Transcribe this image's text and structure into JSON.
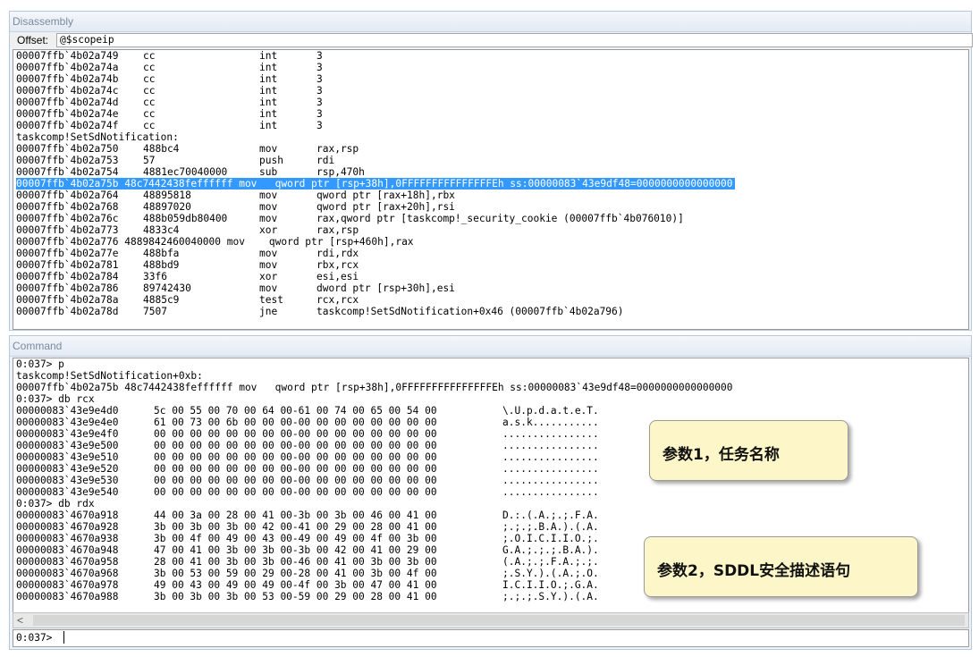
{
  "disassembly": {
    "title": "Disassembly",
    "offset_label": "Offset:",
    "offset_value": "@$scopeip",
    "lines": [
      {
        "addr": "00007ffb`4b02a749",
        "bytes": "cc",
        "mnem": "int",
        "ops": "3"
      },
      {
        "addr": "00007ffb`4b02a74a",
        "bytes": "cc",
        "mnem": "int",
        "ops": "3"
      },
      {
        "addr": "00007ffb`4b02a74b",
        "bytes": "cc",
        "mnem": "int",
        "ops": "3"
      },
      {
        "addr": "00007ffb`4b02a74c",
        "bytes": "cc",
        "mnem": "int",
        "ops": "3"
      },
      {
        "addr": "00007ffb`4b02a74d",
        "bytes": "cc",
        "mnem": "int",
        "ops": "3"
      },
      {
        "addr": "00007ffb`4b02a74e",
        "bytes": "cc",
        "mnem": "int",
        "ops": "3"
      },
      {
        "addr": "00007ffb`4b02a74f",
        "bytes": "cc",
        "mnem": "int",
        "ops": "3"
      },
      {
        "label": "taskcomp!SetSdNotification:"
      },
      {
        "addr": "00007ffb`4b02a750",
        "bytes": "488bc4",
        "mnem": "mov",
        "ops": "rax,rsp"
      },
      {
        "addr": "00007ffb`4b02a753",
        "bytes": "57",
        "mnem": "push",
        "ops": "rdi"
      },
      {
        "addr": "00007ffb`4b02a754",
        "bytes": "4881ec70040000",
        "mnem": "sub",
        "ops": "rsp,470h"
      },
      {
        "highlight": "00007ffb`4b02a75b 48c7442438feffffff mov   qword ptr [rsp+38h],0FFFFFFFFFFFFFFFEh ss:00000083`43e9df48=0000000000000000"
      },
      {
        "addr": "00007ffb`4b02a764",
        "bytes": "48895818",
        "mnem": "mov",
        "ops": "qword ptr [rax+18h],rbx"
      },
      {
        "addr": "00007ffb`4b02a768",
        "bytes": "48897020",
        "mnem": "mov",
        "ops": "qword ptr [rax+20h],rsi"
      },
      {
        "addr": "00007ffb`4b02a76c",
        "bytes": "488b059db80400",
        "mnem": "mov",
        "ops": "rax,qword ptr [taskcomp!_security_cookie (00007ffb`4b076010)]"
      },
      {
        "addr": "00007ffb`4b02a773",
        "bytes": "4833c4",
        "mnem": "xor",
        "ops": "rax,rsp"
      },
      {
        "raw": "00007ffb`4b02a776 4889842460040000 mov    qword ptr [rsp+460h],rax"
      },
      {
        "addr": "00007ffb`4b02a77e",
        "bytes": "488bfa",
        "mnem": "mov",
        "ops": "rdi,rdx"
      },
      {
        "addr": "00007ffb`4b02a781",
        "bytes": "488bd9",
        "mnem": "mov",
        "ops": "rbx,rcx"
      },
      {
        "addr": "00007ffb`4b02a784",
        "bytes": "33f6",
        "mnem": "xor",
        "ops": "esi,esi"
      },
      {
        "addr": "00007ffb`4b02a786",
        "bytes": "89742430",
        "mnem": "mov",
        "ops": "dword ptr [rsp+30h],esi"
      },
      {
        "addr": "00007ffb`4b02a78a",
        "bytes": "4885c9",
        "mnem": "test",
        "ops": "rcx,rcx"
      },
      {
        "addr": "00007ffb`4b02a78d",
        "bytes": "7507",
        "mnem": "jne",
        "ops": "taskcomp!SetSdNotification+0x46 (00007ffb`4b02a796)"
      }
    ]
  },
  "command": {
    "title": "Command",
    "lines": [
      {
        "raw": "0:037> p"
      },
      {
        "raw": "taskcomp!SetSdNotification+0xb:"
      },
      {
        "raw": "00007ffb`4b02a75b 48c7442438feffffff mov   qword ptr [rsp+38h],0FFFFFFFFFFFFFFFEh ss:00000083`43e9df48=0000000000000000"
      },
      {
        "raw": "0:037> db rcx"
      },
      {
        "addr": "00000083`43e9e4d0",
        "hex": "5c 00 55 00 70 00 64 00-61 00 74 00 65 00 54 00",
        "ascii": "\\.U.p.d.a.t.e.T."
      },
      {
        "addr": "00000083`43e9e4e0",
        "hex": "61 00 73 00 6b 00 00 00-00 00 00 00 00 00 00 00",
        "ascii": "a.s.k..........."
      },
      {
        "addr": "00000083`43e9e4f0",
        "hex": "00 00 00 00 00 00 00 00-00 00 00 00 00 00 00 00",
        "ascii": "................"
      },
      {
        "addr": "00000083`43e9e500",
        "hex": "00 00 00 00 00 00 00 00-00 00 00 00 00 00 00 00",
        "ascii": "................"
      },
      {
        "addr": "00000083`43e9e510",
        "hex": "00 00 00 00 00 00 00 00-00 00 00 00 00 00 00 00",
        "ascii": "................"
      },
      {
        "addr": "00000083`43e9e520",
        "hex": "00 00 00 00 00 00 00 00-00 00 00 00 00 00 00 00",
        "ascii": "................"
      },
      {
        "addr": "00000083`43e9e530",
        "hex": "00 00 00 00 00 00 00 00-00 00 00 00 00 00 00 00",
        "ascii": "................"
      },
      {
        "addr": "00000083`43e9e540",
        "hex": "00 00 00 00 00 00 00 00-00 00 00 00 00 00 00 00",
        "ascii": "................"
      },
      {
        "raw": "0:037> db rdx"
      },
      {
        "addr": "00000083`4670a918",
        "hex": "44 00 3a 00 28 00 41 00-3b 00 3b 00 46 00 41 00",
        "ascii": "D.:.(.A.;.;.F.A."
      },
      {
        "addr": "00000083`4670a928",
        "hex": "3b 00 3b 00 3b 00 42 00-41 00 29 00 28 00 41 00",
        "ascii": ";.;.;.B.A.).(.A."
      },
      {
        "addr": "00000083`4670a938",
        "hex": "3b 00 4f 00 49 00 43 00-49 00 49 00 4f 00 3b 00",
        "ascii": ";.O.I.C.I.I.O.;."
      },
      {
        "addr": "00000083`4670a948",
        "hex": "47 00 41 00 3b 00 3b 00-3b 00 42 00 41 00 29 00",
        "ascii": "G.A.;.;.;.B.A.)."
      },
      {
        "addr": "00000083`4670a958",
        "hex": "28 00 41 00 3b 00 3b 00-46 00 41 00 3b 00 3b 00",
        "ascii": "(.A.;.;.F.A.;.;."
      },
      {
        "addr": "00000083`4670a968",
        "hex": "3b 00 53 00 59 00 29 00-28 00 41 00 3b 00 4f 00",
        "ascii": ";.S.Y.).(.A.;.O."
      },
      {
        "addr": "00000083`4670a978",
        "hex": "49 00 43 00 49 00 49 00-4f 00 3b 00 47 00 41 00",
        "ascii": "I.C.I.I.O.;.G.A."
      },
      {
        "addr": "00000083`4670a988",
        "hex": "3b 00 3b 00 3b 00 53 00-59 00 29 00 28 00 41 00",
        "ascii": ";.;.;.S.Y.).(.A."
      }
    ],
    "scroll_left_icon": "chevron-left-icon",
    "scroll_left_glyph": "<",
    "prompt": "0:037>",
    "input_value": ""
  },
  "callouts": {
    "param1": "参数1，任务名称",
    "param2": "参数2，SDDL安全描述语句"
  }
}
